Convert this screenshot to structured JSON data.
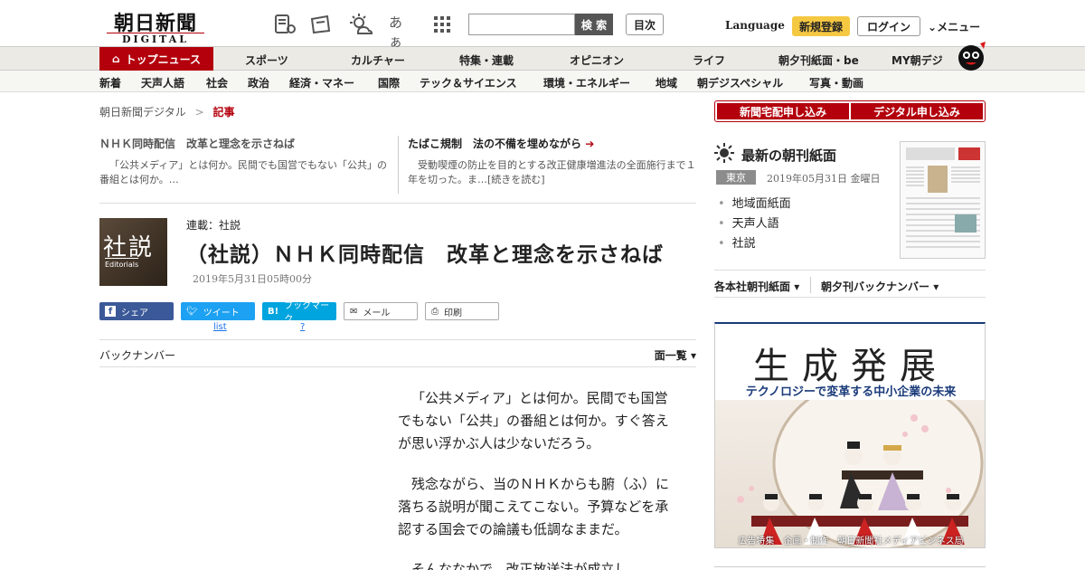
{
  "header": {
    "logo_main": "朝日新聞",
    "logo_sub": "DIGITAL",
    "search_placeholder": "",
    "search_button": "検 索",
    "toc_button": "目次",
    "language": "Language",
    "register": "新規登録",
    "login": "ログイン",
    "menu": "メニュー",
    "font_toggle": "あぁ"
  },
  "nav": {
    "primary": [
      "トップニュース",
      "スポーツ",
      "カルチャー",
      "特集・連載",
      "オピニオン",
      "ライフ",
      "朝夕刊紙面・be",
      "MY朝デジ"
    ],
    "secondary": [
      "新着",
      "天声人語",
      "社会",
      "政治",
      "経済・マネー",
      "国際",
      "テック＆サイエンス",
      "環境・エネルギー",
      "地域",
      "朝デジスペシャル",
      "写真・動画"
    ]
  },
  "breadcrumb": {
    "root": "朝日新聞デジタル",
    "sep": ">",
    "current": "記事"
  },
  "related": [
    {
      "title": "ＮＨＫ同時配信　改革と理念を示さねば",
      "desc": "「公共メディア」とは何か。民間でも国営でもない「公共」の番組とは何か。…"
    },
    {
      "title": "たばこ規制　法の不備を埋めながら",
      "desc": "受動喫煙の防止を目的とする改正健康増進法の全面施行まで１年を切った。ま…[続きを読む]"
    }
  ],
  "article": {
    "image_text": "社説",
    "image_sub": "Editorials",
    "series": "連載：社説",
    "title": "（社説）ＮＨＫ同時配信　改革と理念を示さねば",
    "date": "2019年5月31日05時00分",
    "paragraphs": [
      "「公共メディア」とは何か。民間でも国営でもない「公共」の番組とは何か。すぐ答えが思い浮かぶ人は少ないだろう。",
      "残念ながら、当のＮＨＫからも腑（ふ）に落ちる説明が聞こえてこない。予算などを承認する国会での論議も低調なままだ。",
      "そんななかで、改正放送法が成立し"
    ]
  },
  "share": {
    "facebook": "シェア",
    "twitter": "ツイート",
    "twitter_sub": "list",
    "hatena": "ブックマーク",
    "hatena_sub": "?",
    "mail": "メール",
    "print": "印刷"
  },
  "backnumber": {
    "label": "バックナンバー",
    "dropdown": "面一覧"
  },
  "sidebar": {
    "order_home": "新聞宅配申し込み",
    "order_digital": "デジタル申し込み",
    "latest_title": "最新の朝刊紙面",
    "region": "東京",
    "paper_date": "2019年05月31日 金曜日",
    "paper_links": [
      "地域面紙面",
      "天声人語",
      "社説"
    ],
    "dropdown_1": "各本社朝刊紙面",
    "dropdown_2": "朝夕刊バックナンバー"
  },
  "ad": {
    "headline": "生成発展",
    "subhead": "テクノロジーで変革する中小企業の未来",
    "caption": "広告特集　企画・制作　朝日新聞社メディアビジネス局"
  },
  "colors": {
    "brand_red": "#b3000c",
    "facebook": "#3b5998",
    "twitter": "#1da1f2",
    "hatena": "#00a4de",
    "register": "#f5c842"
  }
}
